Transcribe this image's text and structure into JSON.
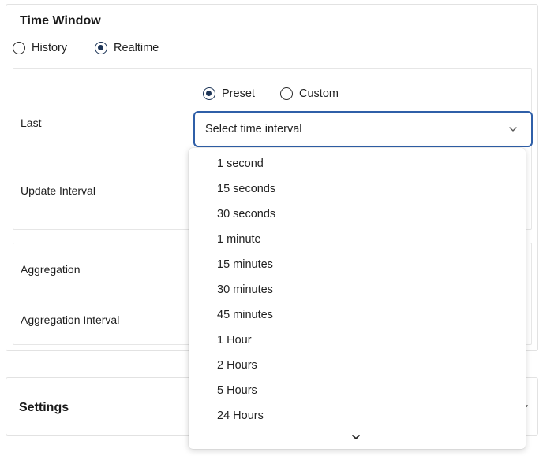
{
  "time_window": {
    "title": "Time Window",
    "mode_options": [
      "History",
      "Realtime"
    ],
    "mode_selected": "Realtime",
    "last": {
      "label": "Last",
      "type_options": [
        "Preset",
        "Custom"
      ],
      "type_selected": "Preset",
      "select_placeholder": "Select time interval",
      "options": [
        "1 second",
        "15 seconds",
        "30 seconds",
        "1 minute",
        "15 minutes",
        "30 minutes",
        "45 minutes",
        "1 Hour",
        "2 Hours",
        "5 Hours",
        "24 Hours"
      ]
    },
    "update_interval_label": "Update Interval",
    "aggregation_label": "Aggregation",
    "aggregation_interval_label": "Aggregation Interval"
  },
  "settings": {
    "title": "Settings"
  },
  "icons": {
    "select_chevron": "chevron-down-icon",
    "scroll_down": "chevron-down-icon",
    "settings_expand": "chevron-down-icon"
  },
  "colors": {
    "accent": "#2f5fa8",
    "radio_fill": "#1d3557",
    "border": "#e2e2e2"
  }
}
